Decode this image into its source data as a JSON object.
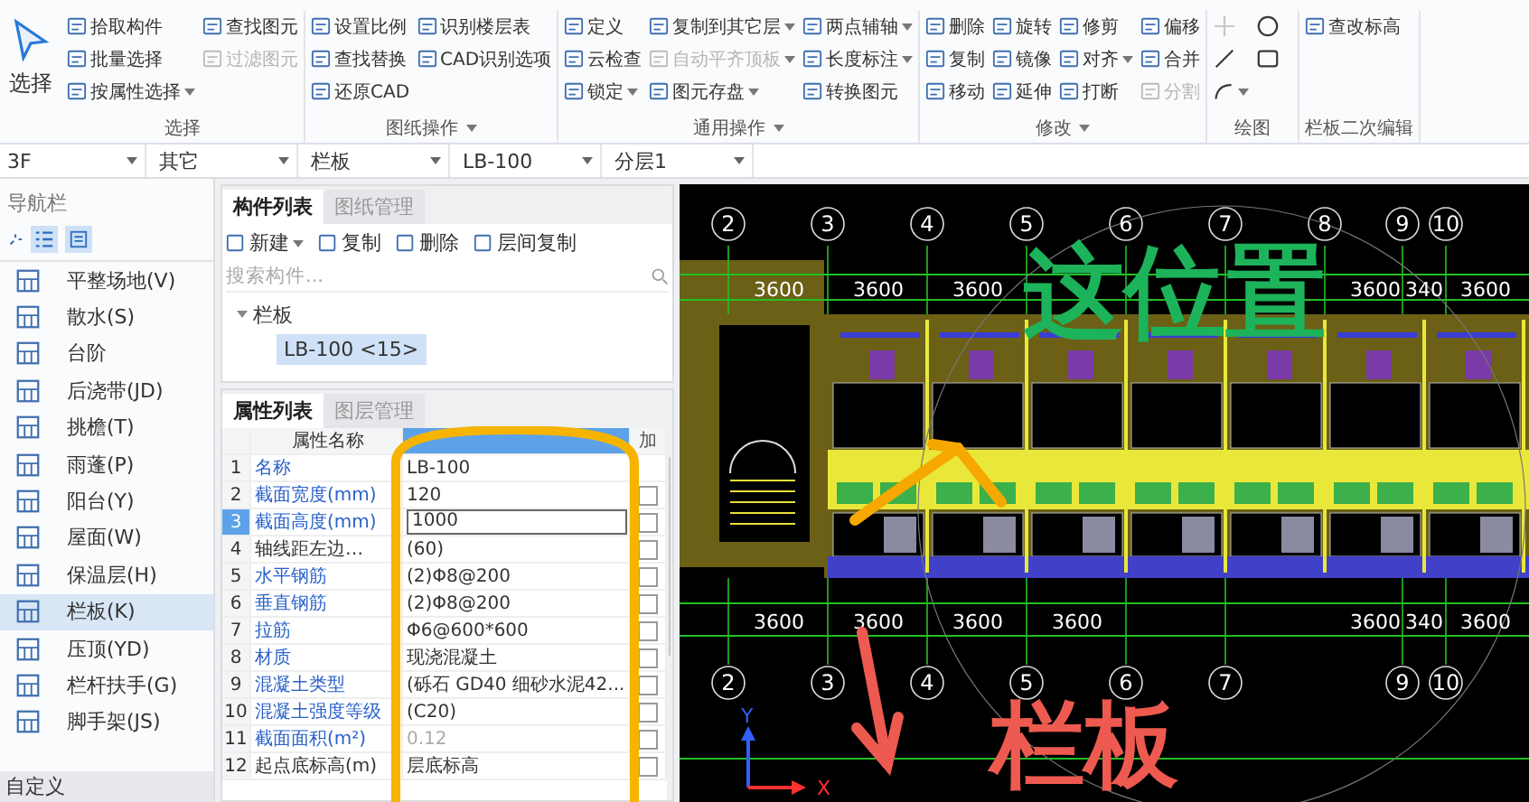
{
  "ribbon": {
    "select_button": {
      "label": "选择"
    },
    "groups": [
      {
        "label": "选择",
        "kind": "tools",
        "dropdown": false,
        "columns": [
          [
            {
              "label": "拾取构件",
              "disabled": false,
              "dropdown": false
            },
            {
              "label": "批量选择",
              "disabled": false,
              "dropdown": false
            },
            {
              "label": "按属性选择",
              "disabled": false,
              "dropdown": true
            }
          ],
          [
            {
              "label": "查找图元",
              "disabled": false,
              "dropdown": false
            },
            {
              "label": "过滤图元",
              "disabled": true,
              "dropdown": false
            }
          ]
        ]
      },
      {
        "label": "图纸操作",
        "kind": "tools",
        "dropdown": true,
        "columns": [
          [
            {
              "label": "设置比例",
              "disabled": false,
              "dropdown": false
            },
            {
              "label": "查找替换",
              "disabled": false,
              "dropdown": false
            },
            {
              "label": "还原CAD",
              "disabled": false,
              "dropdown": false
            }
          ],
          [
            {
              "label": "识别楼层表",
              "disabled": false,
              "dropdown": false
            },
            {
              "label": "CAD识别选项",
              "disabled": false,
              "dropdown": false
            }
          ]
        ]
      },
      {
        "label": "通用操作",
        "kind": "tools",
        "dropdown": true,
        "columns": [
          [
            {
              "label": "定义",
              "disabled": false,
              "dropdown": false
            },
            {
              "label": "云检查",
              "disabled": false,
              "dropdown": false
            },
            {
              "label": "锁定",
              "disabled": false,
              "dropdown": true
            }
          ],
          [
            {
              "label": "复制到其它层",
              "disabled": false,
              "dropdown": true
            },
            {
              "label": "自动平齐顶板",
              "disabled": true,
              "dropdown": true
            },
            {
              "label": "图元存盘",
              "disabled": false,
              "dropdown": true
            }
          ],
          [
            {
              "label": "两点辅轴",
              "disabled": false,
              "dropdown": true
            },
            {
              "label": "长度标注",
              "disabled": false,
              "dropdown": true
            },
            {
              "label": "转换图元",
              "disabled": false,
              "dropdown": false
            }
          ]
        ]
      },
      {
        "label": "修改",
        "kind": "tools",
        "dropdown": true,
        "columns": [
          [
            {
              "label": "删除",
              "disabled": false,
              "dropdown": false
            },
            {
              "label": "复制",
              "disabled": false,
              "dropdown": false
            },
            {
              "label": "移动",
              "disabled": false,
              "dropdown": false
            }
          ],
          [
            {
              "label": "旋转",
              "disabled": false,
              "dropdown": false
            },
            {
              "label": "镜像",
              "disabled": false,
              "dropdown": false
            },
            {
              "label": "延伸",
              "disabled": false,
              "dropdown": false
            }
          ],
          [
            {
              "label": "修剪",
              "disabled": false,
              "dropdown": false
            },
            {
              "label": "对齐",
              "disabled": false,
              "dropdown": true
            },
            {
              "label": "打断",
              "disabled": false,
              "dropdown": false
            }
          ],
          [
            {
              "label": "偏移",
              "disabled": false,
              "dropdown": false
            },
            {
              "label": "合并",
              "disabled": false,
              "dropdown": false
            },
            {
              "label": "分割",
              "disabled": true,
              "dropdown": false
            }
          ]
        ]
      },
      {
        "label": "绘图",
        "kind": "shapes",
        "dropdown": false,
        "columns": [
          [
            {
              "kind": "point",
              "disabled": true,
              "dropdown": false
            },
            {
              "kind": "line",
              "disabled": false,
              "dropdown": false
            },
            {
              "kind": "arc",
              "disabled": false,
              "dropdown": true
            }
          ],
          [
            {
              "kind": "circle",
              "disabled": false,
              "dropdown": false
            },
            {
              "kind": "rect",
              "disabled": false,
              "dropdown": false
            }
          ]
        ]
      },
      {
        "label": "栏板二次编辑",
        "kind": "tools",
        "dropdown": false,
        "columns": [
          [
            {
              "label": "查改标高",
              "disabled": false,
              "dropdown": false
            }
          ]
        ]
      }
    ]
  },
  "selectors": [
    {
      "value": "3F"
    },
    {
      "value": "其它"
    },
    {
      "value": "栏板"
    },
    {
      "value": "LB-100"
    },
    {
      "value": "分层1"
    }
  ],
  "nav": {
    "title": "导航栏",
    "view_buttons": [
      {
        "selected": true
      },
      {
        "selected": true
      }
    ],
    "items": [
      {
        "label": "平整场地(V)",
        "selected": false
      },
      {
        "label": "散水(S)",
        "selected": false
      },
      {
        "label": "台阶",
        "selected": false
      },
      {
        "label": "后浇带(JD)",
        "selected": false
      },
      {
        "label": "挑檐(T)",
        "selected": false
      },
      {
        "label": "雨蓬(P)",
        "selected": false
      },
      {
        "label": "阳台(Y)",
        "selected": false
      },
      {
        "label": "屋面(W)",
        "selected": false
      },
      {
        "label": "保温层(H)",
        "selected": false
      },
      {
        "label": "栏板(K)",
        "selected": true
      },
      {
        "label": "压顶(YD)",
        "selected": false
      },
      {
        "label": "栏杆扶手(G)",
        "selected": false
      },
      {
        "label": "脚手架(JS)",
        "selected": false
      }
    ],
    "footer": "自定义"
  },
  "components": {
    "tabs": [
      {
        "label": "构件列表",
        "selected": true
      },
      {
        "label": "图纸管理",
        "selected": false
      }
    ],
    "toolbar": [
      {
        "label": "新建",
        "dropdown": true
      },
      {
        "label": "复制",
        "dropdown": false
      },
      {
        "label": "删除",
        "dropdown": false
      },
      {
        "label": "层间复制",
        "dropdown": false
      }
    ],
    "search": {
      "placeholder": "搜索构件..."
    },
    "tree": [
      {
        "label": "栏板",
        "expanded": true,
        "children": [
          {
            "label": "LB-100 <15>",
            "selected": true
          }
        ]
      }
    ]
  },
  "properties": {
    "tabs": [
      {
        "label": "属性列表",
        "selected": true
      },
      {
        "label": "图层管理",
        "selected": false
      }
    ],
    "header": {
      "name": "属性名称",
      "column_3": "加"
    },
    "rows": [
      {
        "index": "1",
        "name": "名称",
        "value": "LB-100",
        "public": true,
        "selected": false,
        "disabled": false
      },
      {
        "index": "2",
        "name": "截面宽度(mm)",
        "value": "120",
        "public": true,
        "selected": false,
        "disabled": false,
        "checked": false
      },
      {
        "index": "3",
        "name": "截面高度(mm)",
        "value": "1000",
        "public": true,
        "selected": true,
        "disabled": false,
        "checked": false
      },
      {
        "index": "4",
        "name": "轴线距左边…",
        "value": "(60)",
        "public": false,
        "selected": false,
        "disabled": false,
        "checked": false
      },
      {
        "index": "5",
        "name": "水平钢筋",
        "value": "(2)Φ8@200",
        "public": true,
        "selected": false,
        "disabled": false,
        "checked": false
      },
      {
        "index": "6",
        "name": "垂直钢筋",
        "value": "(2)Φ8@200",
        "public": true,
        "selected": false,
        "disabled": false,
        "checked": false
      },
      {
        "index": "7",
        "name": "拉筋",
        "value": "Φ6@600*600",
        "public": true,
        "selected": false,
        "disabled": false,
        "checked": false
      },
      {
        "index": "8",
        "name": "材质",
        "value": "现浇混凝土",
        "public": true,
        "selected": false,
        "disabled": false,
        "checked": false
      },
      {
        "index": "9",
        "name": "混凝土类型",
        "value": "(砾石 GD40 细砂水泥42...",
        "public": true,
        "selected": false,
        "disabled": false,
        "checked": false
      },
      {
        "index": "10",
        "name": "混凝土强度等级",
        "value": "(C20)",
        "public": true,
        "selected": false,
        "disabled": false,
        "checked": false
      },
      {
        "index": "11",
        "name": "截面面积(m²)",
        "value": "0.12",
        "public": true,
        "selected": false,
        "disabled": true,
        "checked": false
      },
      {
        "index": "12",
        "name": "起点底标高(m)",
        "value": "层底标高",
        "public": false,
        "selected": false,
        "disabled": false,
        "checked": false
      }
    ]
  },
  "cad": {
    "top_axis": [
      "2",
      "3",
      "4",
      "5",
      "6",
      "7",
      "8",
      "9",
      "10"
    ],
    "top_dims": [
      "3600",
      "3600",
      "3600",
      "3600",
      "340",
      "3600"
    ],
    "bottom_dims": [
      "3600",
      "3600",
      "3600",
      "3600",
      "3600",
      "340",
      "3600"
    ],
    "bottom_axis": [
      "2",
      "3",
      "4",
      "5",
      "6",
      "7",
      "9",
      "10"
    ],
    "ucs": {
      "x_label": "X",
      "y_label": "Y"
    }
  },
  "annotations": [
    {
      "kind": "ellipse",
      "color": "#f6b400"
    },
    {
      "kind": "arrow",
      "color": "#f6a800"
    },
    {
      "kind": "text",
      "text": "这位置",
      "color": "#1db35a"
    },
    {
      "kind": "arrow",
      "color": "#ee5a50"
    },
    {
      "kind": "text",
      "text": "栏板",
      "color": "#ee5a50"
    }
  ]
}
